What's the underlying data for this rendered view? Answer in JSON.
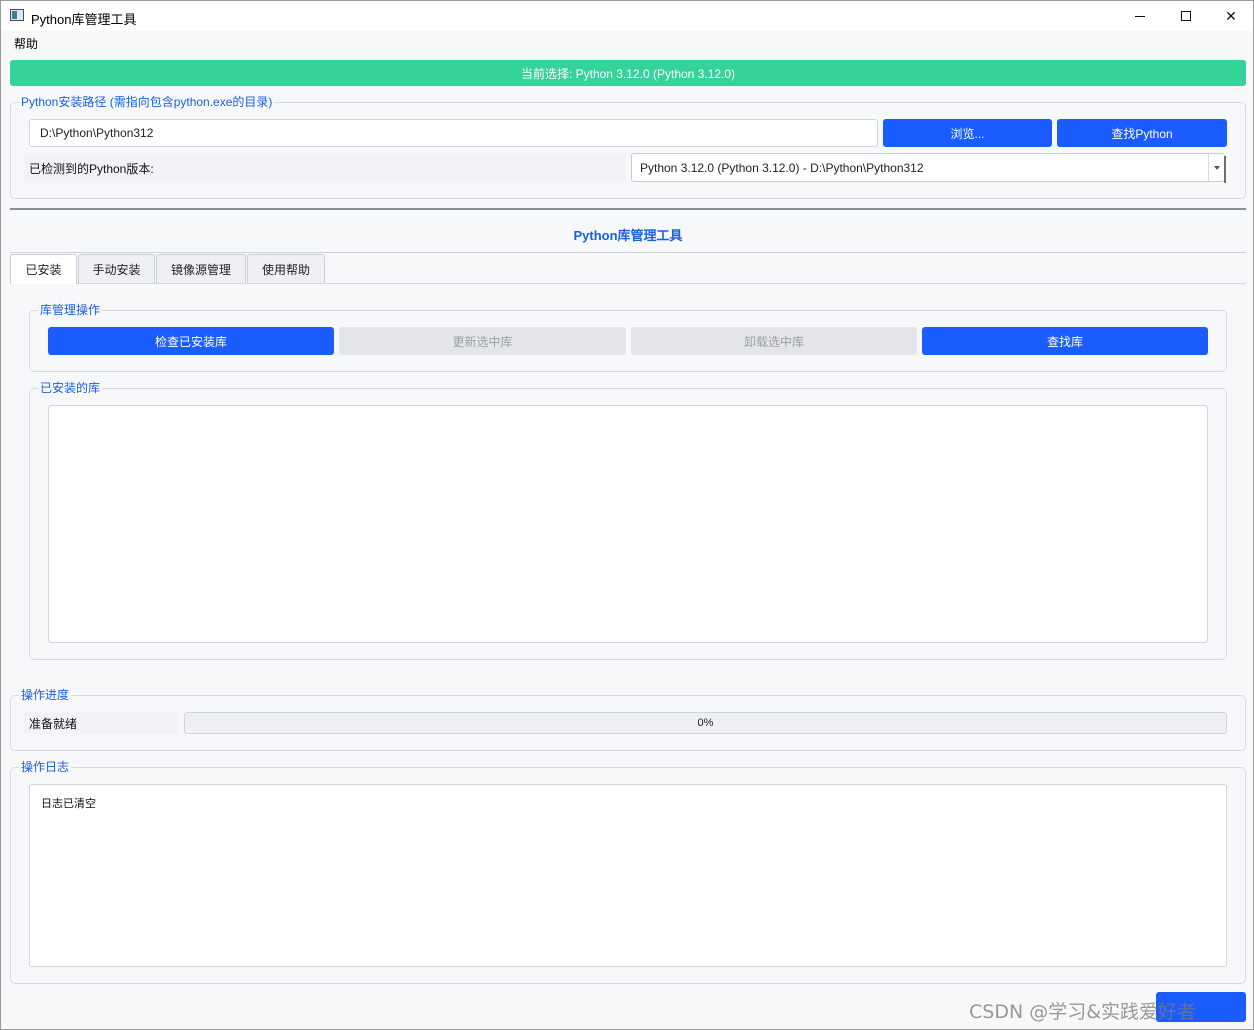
{
  "window": {
    "title": "Python库管理工具",
    "controls": [
      "minimize-icon",
      "maximize-icon",
      "close-icon"
    ]
  },
  "menubar": {
    "items": [
      "帮助"
    ]
  },
  "banner": {
    "text": "当前选择: Python 3.12.0 (Python 3.12.0)",
    "color": "#34d399"
  },
  "python_path": {
    "group_title": "Python安装路径 (需指向包含python.exe的目录)",
    "path_value": "D:\\Python\\Python312",
    "browse_label": "浏览...",
    "find_label": "查找Python",
    "detected_label": "已检测到的Python版本:",
    "detected_value": "Python 3.12.0 (Python 3.12.0) - D:\\Python\\Python312"
  },
  "main": {
    "heading": "Python库管理工具",
    "tabs": [
      {
        "label": "已安装",
        "active": true
      },
      {
        "label": "手动安装",
        "active": false
      },
      {
        "label": "镜像源管理",
        "active": false
      },
      {
        "label": "使用帮助",
        "active": false
      }
    ]
  },
  "library_ops": {
    "group_title": "库管理操作",
    "check_label": "检查已安装库",
    "update_label": "更新选中库",
    "uninstall_label": "卸载选中库",
    "find_label": "查找库"
  },
  "installed": {
    "group_title": "已安装的库",
    "items": []
  },
  "progress": {
    "group_title": "操作进度",
    "status": "准备就绪",
    "value": 0,
    "text": "0%"
  },
  "log": {
    "group_title": "操作日志",
    "lines": [
      "日志已清空"
    ]
  },
  "watermark": "CSDN @学习&实践爱好者",
  "colors": {
    "accent": "#1a5cff",
    "success": "#34d399",
    "heading": "#1a5fe0"
  }
}
